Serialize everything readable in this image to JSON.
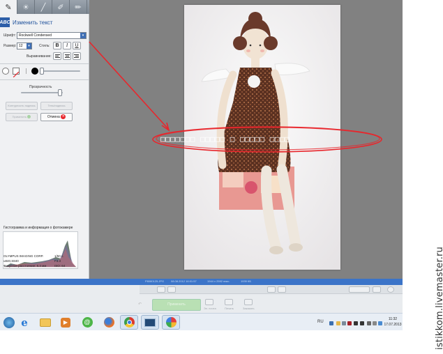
{
  "left_panel": {
    "title": "Изменить текст",
    "font_label": "Шрифт:",
    "font_value": "Rockwell Condensed",
    "size_label": "Размер:",
    "size_value": "12",
    "style_label": "Стиль:",
    "style_buttons": [
      "B",
      "I",
      "U"
    ],
    "align_label": "Выравнивание:",
    "opacity_label": "Прозрачность",
    "bg_btn_1": "Контурность подпись",
    "bg_btn_2": "Тень/надпись",
    "apply_label": "Применить",
    "cancel_label": "Отмена"
  },
  "histogram": {
    "title": "Гистограмма и информация о фотокамере",
    "camera": "OLYMPUS IMAGING CORP.",
    "model": "u840,S840",
    "shutter": "1/50 с.",
    "aperture": "F3.3",
    "focal_label": "Фокусное расстояние: 6.4 мм",
    "iso": "ISO: 64"
  },
  "canvas": {
    "overlay_text": "□□□□□□□ □□□□□ □ □□□□□ □□□□"
  },
  "status_bar": {
    "items": [
      "P8080125.JPG",
      "08.08.2012 16:01:57",
      "1944 x 2592 пикс.",
      "1939 КБ"
    ]
  },
  "bottom_panel": {
    "apply_big": "Применить",
    "labels": [
      "Эл. почта",
      "Печать",
      "Заказать"
    ]
  },
  "taskbar": {
    "lang": "RU",
    "time": "11:32",
    "date": "17.07.2013"
  },
  "watermark": "istikkom.livemaster.ru",
  "colors": {
    "accent_blue": "#3b74c8",
    "annotation_red": "#e8262c",
    "canvas_gray": "#818181",
    "panel_bg": "#f0f1f3"
  }
}
